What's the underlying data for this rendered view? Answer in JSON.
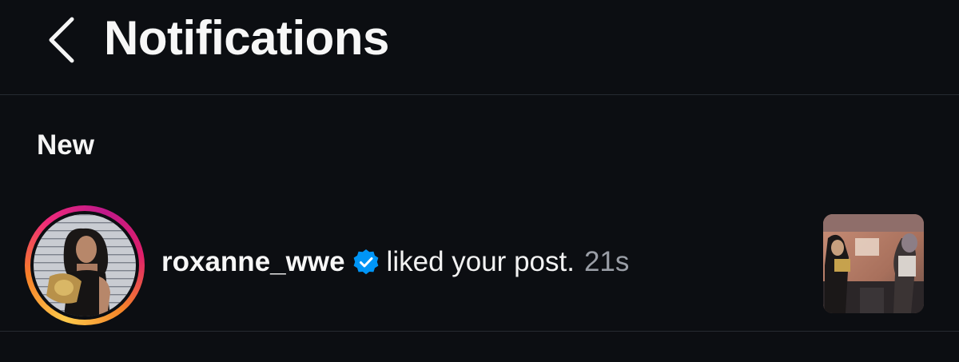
{
  "header": {
    "title": "Notifications",
    "back_icon": "chevron-left-icon"
  },
  "section": {
    "label": "New"
  },
  "notifications": [
    {
      "username": "roxanne_wwe",
      "verified": true,
      "verified_icon": "verified-badge-icon",
      "action": "liked your post.",
      "time": "21s"
    }
  ],
  "colors": {
    "background": "#0c0e12",
    "divider": "#262a31",
    "verified_blue": "#0095f6",
    "muted_text": "#9a9ea6",
    "story_ring": [
      "#fdc94b",
      "#f77f28",
      "#ee2a7b",
      "#c0198a"
    ]
  }
}
